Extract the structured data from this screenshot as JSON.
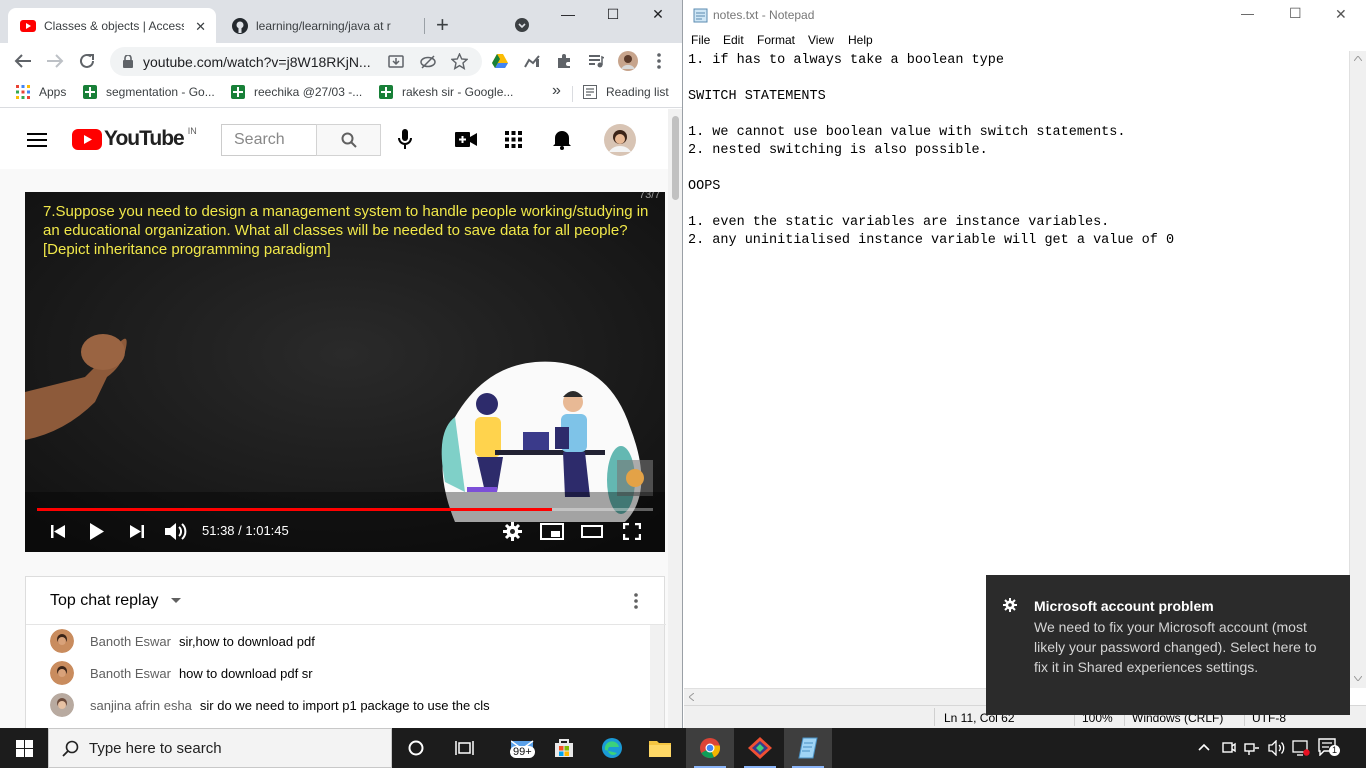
{
  "chrome": {
    "tabs": [
      {
        "title": "Classes & objects | Access",
        "close": "✕"
      },
      {
        "title": "learning/learning/java at r"
      }
    ],
    "new_tab": "+",
    "url": "youtube.com/watch?v=j8W18RKjN...",
    "bookmarks": [
      {
        "label": "Apps"
      },
      {
        "label": "segmentation - Go..."
      },
      {
        "label": "reechika @27/03 -..."
      },
      {
        "label": "rakesh sir - Google..."
      }
    ],
    "bookmarks_more": "»",
    "reading_list": "Reading list",
    "window_controls": {
      "minimize": "—",
      "maximize": "☐",
      "close": "✕"
    }
  },
  "youtube": {
    "logo_text": "YouTube",
    "country": "IN",
    "search_placeholder": "Search",
    "video": {
      "slide_text": "7.Suppose you need to design a management system to handle people working/studying in an educational organization. What all classes will be needed to save data for all people? [Depict inheritance programming paradigm]",
      "corner_text": "73/7",
      "current_time": "51:38",
      "duration": "1:01:45",
      "time_display": "51:38 / 1:01:45",
      "progress": 0.836
    },
    "chat": {
      "title": "Top chat replay",
      "messages": [
        {
          "author": "Banoth Eswar",
          "text": "sir,how to download pdf"
        },
        {
          "author": "Banoth Eswar",
          "text": "how to download pdf sr"
        },
        {
          "author": "sanjina afrin esha",
          "text": "sir do we need to import p1 package to use the cls"
        }
      ]
    }
  },
  "notepad": {
    "title": "notes.txt - Notepad",
    "menu": [
      "File",
      "Edit",
      "Format",
      "View",
      "Help"
    ],
    "content": "1. if has to always take a boolean type\n\nSWITCH STATEMENTS\n\n1. we cannot use boolean value with switch statements.\n2. nested switching is also possible.\n\nOOPS\n\n1. even the static variables are instance variables.\n2. any uninitialised instance variable will get a value of 0",
    "status": {
      "position": "Ln 11, Col 62",
      "zoom": "100%",
      "line_ending": "Windows (CRLF)",
      "encoding": "UTF-8"
    }
  },
  "toast": {
    "title": "Microsoft account problem",
    "body": "We need to fix your Microsoft account (most likely your password changed). Select here to fix it in Shared experiences settings."
  },
  "taskbar": {
    "search_placeholder": "Type here to search",
    "mail_badge": "99+",
    "notification_count": "1"
  }
}
